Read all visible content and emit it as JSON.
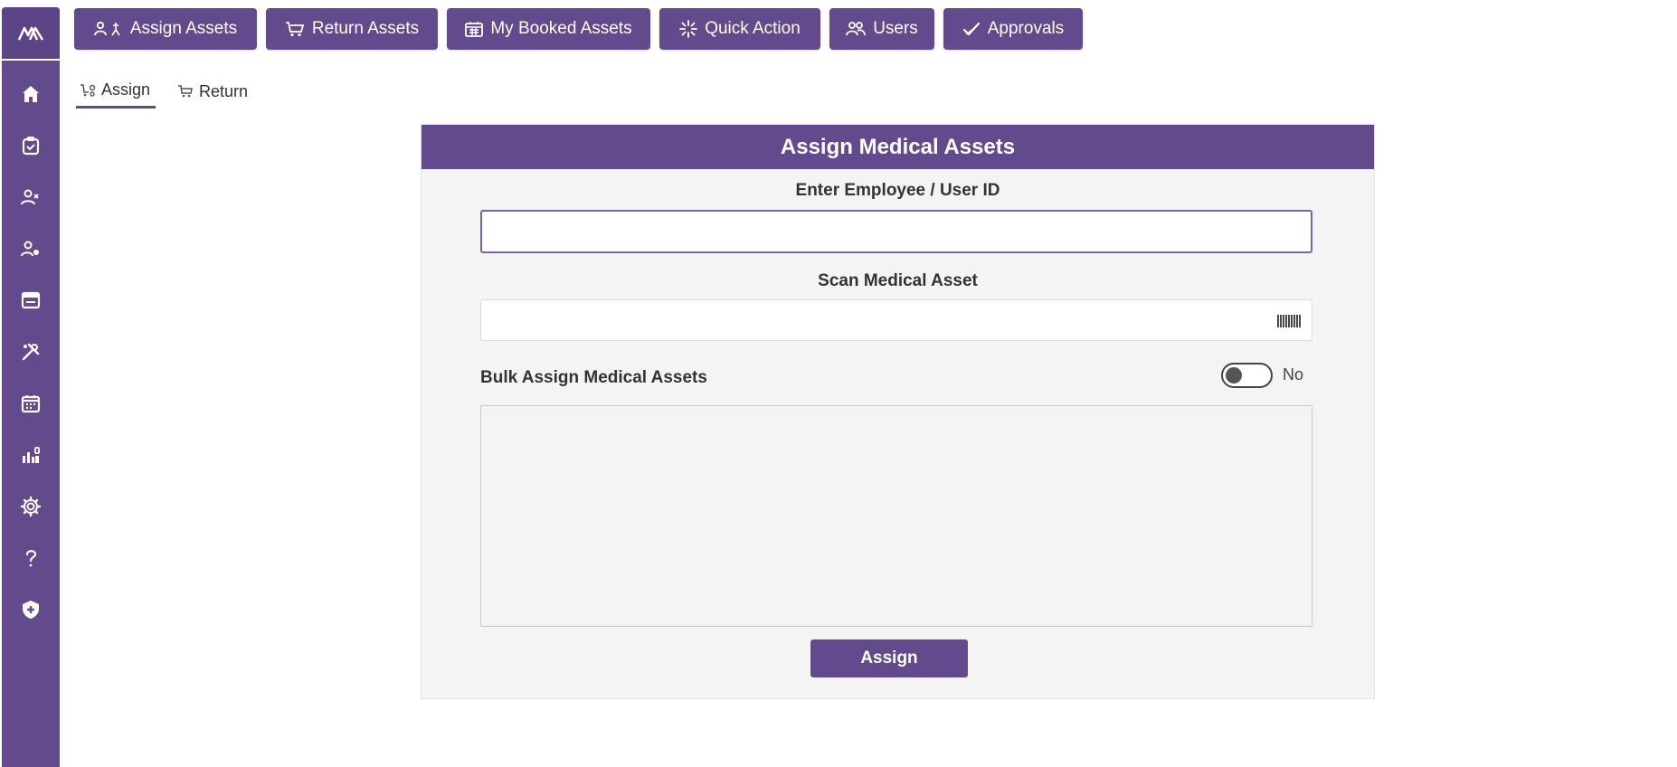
{
  "top_nav": [
    {
      "label": "Assign Assets",
      "icon": "user-assign-icon"
    },
    {
      "label": "Return Assets",
      "icon": "cart-return-icon"
    },
    {
      "label": "My Booked Assets",
      "icon": "calendar-icon"
    },
    {
      "label": "Quick Action",
      "icon": "sparkle-icon"
    },
    {
      "label": "Users",
      "icon": "users-icon"
    },
    {
      "label": "Approvals",
      "icon": "approve-icon"
    }
  ],
  "sidebar": [
    "home-icon",
    "clipboard-icon",
    "user-group-icon",
    "user-settings-icon",
    "assets-card-icon",
    "tools-icon",
    "calendar-icon",
    "reports-icon",
    "settings-gear-icon",
    "help-icon",
    "security-shield-icon"
  ],
  "subtabs": [
    {
      "label": "Assign",
      "active": true
    },
    {
      "label": "Return",
      "active": false
    }
  ],
  "form": {
    "title": "Assign Medical Assets",
    "employee_label": "Enter Employee / User ID",
    "employee_value": "",
    "scan_label": "Scan Medical Asset",
    "scan_value": "",
    "bulk_label": "Bulk Assign Medical Assets",
    "bulk_toggle_text": "No",
    "bulk_value": "",
    "submit_label": "Assign"
  },
  "colors": {
    "primary": "#634a8c",
    "card_bg": "#f4f4f4"
  }
}
